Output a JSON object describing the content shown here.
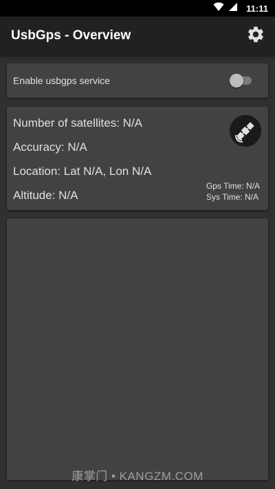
{
  "status_bar": {
    "time": "11:11",
    "icons": [
      "wifi-icon",
      "signal-icon"
    ]
  },
  "app_bar": {
    "title": "UsbGps - Overview",
    "settings_icon": "gear-icon"
  },
  "service_card": {
    "label": "Enable usbgps service",
    "enabled": false
  },
  "info_card": {
    "satellites": "Number of satellites: N/A",
    "accuracy": "Accuracy: N/A",
    "location": "Location: Lat N/A, Lon N/A",
    "altitude": "Altitude: N/A",
    "gps_time": "Gps Time: N/A",
    "sys_time": "Sys Time: N/A",
    "status_icon": "satellite-icon"
  },
  "watermark": "康掌门 • KANGZM.COM",
  "colors": {
    "background": "#303030",
    "app_bar": "#212121",
    "card": "#424242",
    "text": "#e0e0e0"
  }
}
